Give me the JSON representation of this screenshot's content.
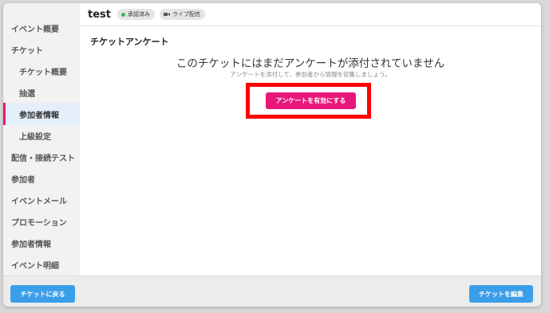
{
  "header": {
    "event_title": "test",
    "badges": [
      {
        "label": "承認済み",
        "icon": "status-dot-icon",
        "color": "#3cb44b"
      },
      {
        "label": "ライブ配信",
        "icon": "video-camera-icon"
      }
    ]
  },
  "sidebar": {
    "items": [
      {
        "label": "イベント概要",
        "level": "top",
        "active": false
      },
      {
        "label": "チケット",
        "level": "top",
        "active": false
      },
      {
        "label": "チケット概要",
        "level": "sub",
        "active": false
      },
      {
        "label": "抽選",
        "level": "sub",
        "active": false
      },
      {
        "label": "参加者情報",
        "level": "sub",
        "active": true
      },
      {
        "label": "上級設定",
        "level": "sub",
        "active": false
      },
      {
        "label": "配信・接続テスト",
        "level": "top",
        "active": false
      },
      {
        "label": "参加者",
        "level": "top",
        "active": false
      },
      {
        "label": "イベントメール",
        "level": "top",
        "active": false
      },
      {
        "label": "プロモーション",
        "level": "top",
        "active": false
      },
      {
        "label": "参加者情報",
        "level": "top",
        "active": false
      },
      {
        "label": "イベント明細",
        "level": "top",
        "active": false
      }
    ]
  },
  "main": {
    "section_title": "チケットアンケート",
    "empty_title": "このチケットにはまだアンケートが添付されていません",
    "empty_subtitle": "アンケートを添付して、参加者から情報を収集しましょう。",
    "enable_button": "アンケートを有効にする"
  },
  "footer": {
    "back_button": "チケットに戻る",
    "edit_button": "チケットを編集"
  },
  "colors": {
    "accent_pink": "#e8177a",
    "primary_blue": "#3a9ee8",
    "highlight_red": "#ff0000"
  }
}
